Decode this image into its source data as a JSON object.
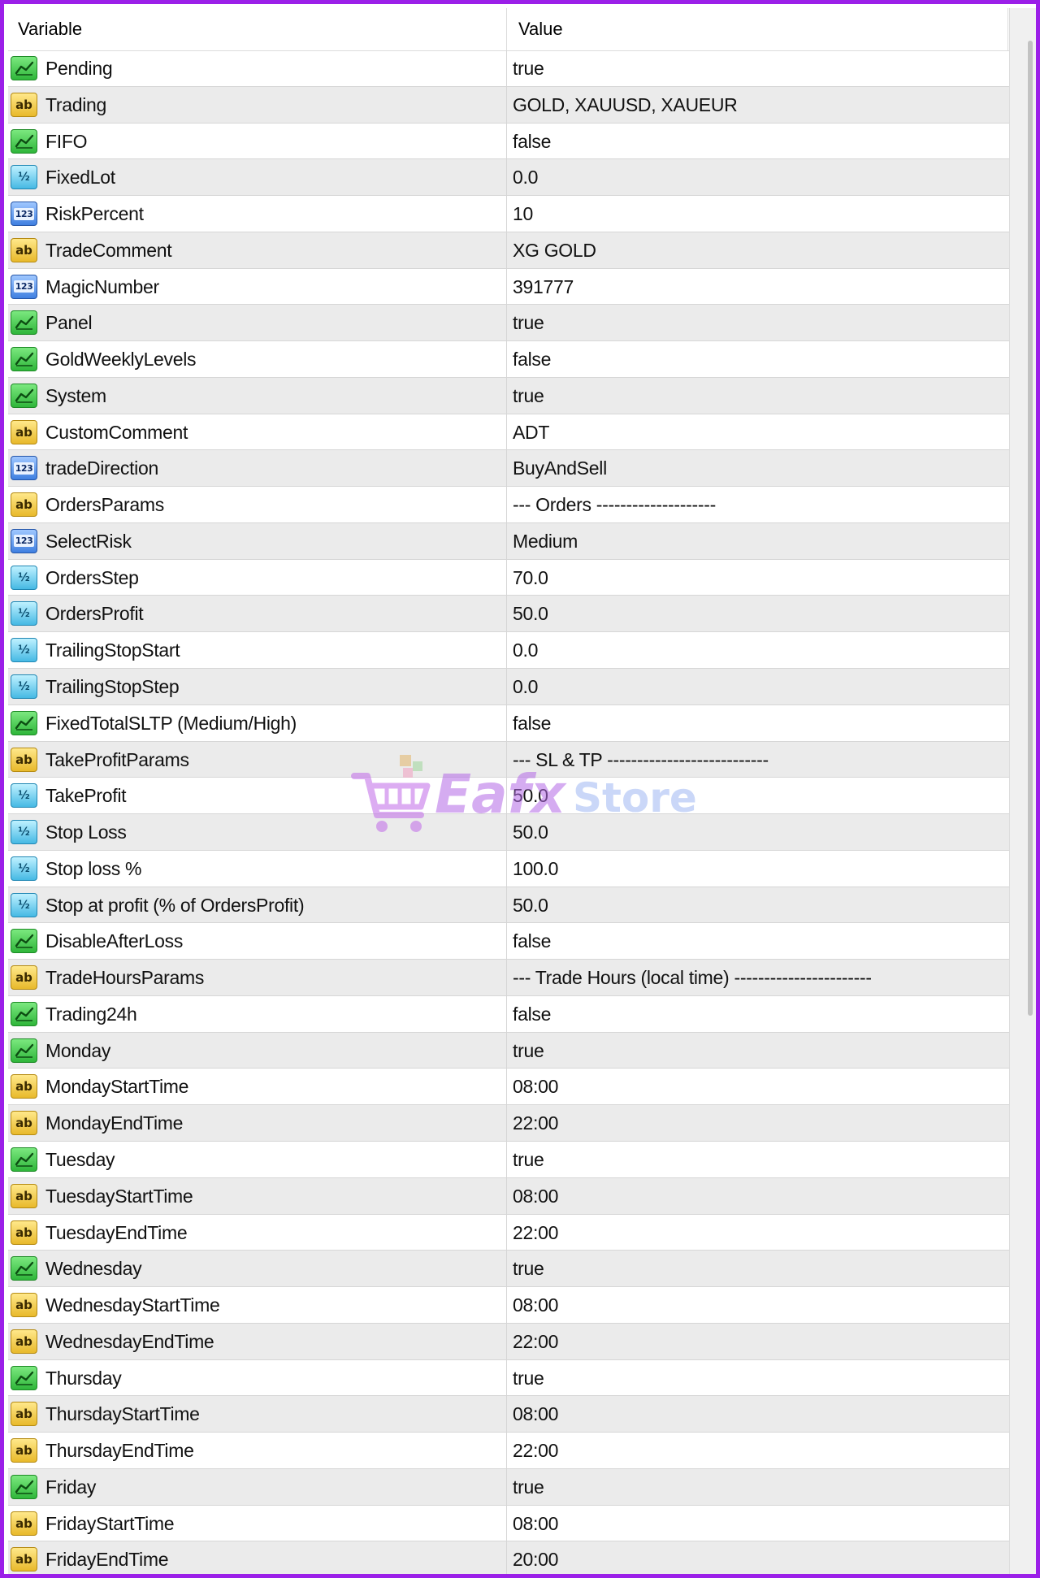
{
  "header": {
    "variable": "Variable",
    "value": "Value"
  },
  "watermark": {
    "brand": "Eafx",
    "suffix": "Store"
  },
  "rows": [
    {
      "type": "bool",
      "name": "Pending",
      "value": "true"
    },
    {
      "type": "str",
      "name": "Trading",
      "value": "GOLD, XAUUSD, XAUEUR"
    },
    {
      "type": "bool",
      "name": "FIFO",
      "value": "false"
    },
    {
      "type": "dbl",
      "name": "FixedLot",
      "value": "0.0"
    },
    {
      "type": "int",
      "name": "RiskPercent",
      "value": "10"
    },
    {
      "type": "str",
      "name": "TradeComment",
      "value": "XG GOLD"
    },
    {
      "type": "int",
      "name": "MagicNumber",
      "value": "391777"
    },
    {
      "type": "bool",
      "name": "Panel",
      "value": "true"
    },
    {
      "type": "bool",
      "name": "GoldWeeklyLevels",
      "value": "false"
    },
    {
      "type": "bool",
      "name": "System",
      "value": "true"
    },
    {
      "type": "str",
      "name": "CustomComment",
      "value": "ADT"
    },
    {
      "type": "int",
      "name": "tradeDirection",
      "value": "BuyAndSell"
    },
    {
      "type": "str",
      "name": "OrdersParams",
      "value": "--- Orders --------------------"
    },
    {
      "type": "int",
      "name": "SelectRisk",
      "value": "Medium"
    },
    {
      "type": "dbl",
      "name": "OrdersStep",
      "value": "70.0"
    },
    {
      "type": "dbl",
      "name": "OrdersProfit",
      "value": "50.0"
    },
    {
      "type": "dbl",
      "name": "TrailingStopStart",
      "value": "0.0"
    },
    {
      "type": "dbl",
      "name": "TrailingStopStep",
      "value": "0.0"
    },
    {
      "type": "bool",
      "name": "FixedTotalSLTP (Medium/High)",
      "value": "false"
    },
    {
      "type": "str",
      "name": "TakeProfitParams",
      "value": "--- SL & TP ---------------------------"
    },
    {
      "type": "dbl",
      "name": "TakeProfit",
      "value": "50.0"
    },
    {
      "type": "dbl",
      "name": "Stop Loss",
      "value": "50.0"
    },
    {
      "type": "dbl",
      "name": "Stop loss %",
      "value": "100.0"
    },
    {
      "type": "dbl",
      "name": "Stop at profit (% of OrdersProfit)",
      "value": "50.0"
    },
    {
      "type": "bool",
      "name": "DisableAfterLoss",
      "value": "false"
    },
    {
      "type": "str",
      "name": "TradeHoursParams",
      "value": "--- Trade Hours  (local time) -----------------------"
    },
    {
      "type": "bool",
      "name": "Trading24h",
      "value": "false"
    },
    {
      "type": "bool",
      "name": "Monday",
      "value": "true"
    },
    {
      "type": "str",
      "name": "MondayStartTime",
      "value": "08:00"
    },
    {
      "type": "str",
      "name": "MondayEndTime",
      "value": "22:00"
    },
    {
      "type": "bool",
      "name": "Tuesday",
      "value": "true"
    },
    {
      "type": "str",
      "name": "TuesdayStartTime",
      "value": "08:00"
    },
    {
      "type": "str",
      "name": "TuesdayEndTime",
      "value": "22:00"
    },
    {
      "type": "bool",
      "name": "Wednesday",
      "value": "true"
    },
    {
      "type": "str",
      "name": "WednesdayStartTime",
      "value": "08:00"
    },
    {
      "type": "str",
      "name": "WednesdayEndTime",
      "value": "22:00"
    },
    {
      "type": "bool",
      "name": "Thursday",
      "value": "true"
    },
    {
      "type": "str",
      "name": "ThursdayStartTime",
      "value": "08:00"
    },
    {
      "type": "str",
      "name": "ThursdayEndTime",
      "value": "22:00"
    },
    {
      "type": "bool",
      "name": "Friday",
      "value": "true"
    },
    {
      "type": "str",
      "name": "FridayStartTime",
      "value": "08:00"
    },
    {
      "type": "str",
      "name": "FridayEndTime",
      "value": "20:00"
    }
  ],
  "icons": {
    "bool": "bool-toggle-icon",
    "str": "string-ab-icon",
    "int": "integer-123-icon",
    "dbl": "double-half-icon"
  }
}
